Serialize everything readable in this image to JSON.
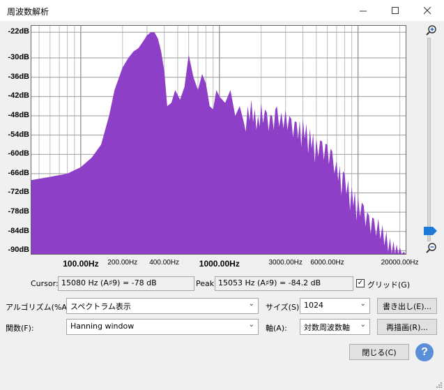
{
  "window": {
    "title": "周波数解析",
    "minimize_icon": "minimize-icon",
    "maximize_icon": "maximize-icon",
    "close_icon": "close-icon"
  },
  "plot": {
    "y_ticks": [
      "-22dB",
      "-30dB",
      "-36dB",
      "-42dB",
      "-48dB",
      "-54dB",
      "-60dB",
      "-66dB",
      "-72dB",
      "-78dB",
      "-84dB",
      "-90dB"
    ],
    "x_ticks": [
      {
        "label": "100.00Hz",
        "major": true
      },
      {
        "label": "200.00Hz",
        "major": false
      },
      {
        "label": "400.00Hz",
        "major": false
      },
      {
        "label": "1000.00Hz",
        "major": true
      },
      {
        "label": "3000.00Hz",
        "major": false
      },
      {
        "label": "6000.00Hz",
        "major": false
      },
      {
        "label": "20000.00Hz",
        "major": false
      }
    ],
    "fill_color": "#8e3fc8"
  },
  "chart_data": {
    "type": "area",
    "xscale": "log",
    "xlim": [
      44,
      22050
    ],
    "ylim": [
      -91,
      -20
    ],
    "x": [
      44,
      60,
      80,
      100,
      120,
      140,
      160,
      175,
      200,
      220,
      240,
      260,
      280,
      300,
      320,
      340,
      360,
      380,
      400,
      420,
      450,
      480,
      520,
      560,
      600,
      650,
      700,
      750,
      800,
      850,
      900,
      950,
      1000,
      1100,
      1200,
      1300,
      1400,
      1500,
      1600,
      1700,
      1800,
      1900,
      2000,
      2200,
      2400,
      2600,
      2800,
      3000,
      3300,
      3600,
      4000,
      4500,
      5000,
      5500,
      6000,
      6500,
      7000,
      8000,
      9000,
      10000,
      11000,
      12000,
      13000,
      14000,
      15000,
      16000,
      17000,
      18000,
      19000,
      20000,
      22050
    ],
    "y": [
      -68,
      -67,
      -66,
      -64,
      -61,
      -57,
      -48,
      -40,
      -33,
      -30,
      -28,
      -27,
      -25,
      -23,
      -22,
      -22,
      -24,
      -28,
      -34,
      -45,
      -44,
      -40,
      -43,
      -39,
      -29,
      -36,
      -40,
      -35,
      -38,
      -45,
      -46,
      -40,
      -42,
      -44,
      -40,
      -48,
      -45,
      -50,
      -45,
      -43,
      -46,
      -48,
      -44,
      -47,
      -48,
      -45,
      -47,
      -46,
      -49,
      -50,
      -49,
      -52,
      -55,
      -56,
      -57,
      -59,
      -62,
      -66,
      -70,
      -73,
      -76,
      -79,
      -80,
      -80,
      -82,
      -84,
      -86,
      -87,
      -88,
      -89,
      -91
    ]
  },
  "cursor": {
    "label": "Cursor:",
    "value": "15080 Hz (A♯9) = -78 dB"
  },
  "peak": {
    "label": "Peak:",
    "value": "15053 Hz (A♯9) = -84.2 dB"
  },
  "grid": {
    "label": "グリッド(G)",
    "checked": "✓"
  },
  "algorithm": {
    "label": "アルゴリズム(%A):",
    "value": "スペクトラム表示"
  },
  "size": {
    "label": "サイズ(S):",
    "value": "1024"
  },
  "function": {
    "label": "関数(F):",
    "value": "Hanning window"
  },
  "axis": {
    "label": "軸(A):",
    "value": "対数周波数軸"
  },
  "buttons": {
    "export": "書き出し(E)...",
    "replot": "再描画(R)...",
    "close": "閉じる(C)",
    "help": "?"
  }
}
